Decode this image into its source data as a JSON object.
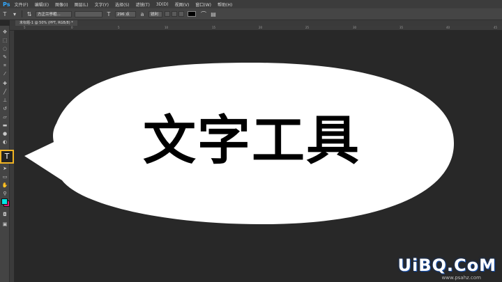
{
  "app": {
    "logo": "Ps"
  },
  "menu": [
    "文件(F)",
    "编辑(E)",
    "图像(I)",
    "图层(L)",
    "文字(Y)",
    "选择(S)",
    "滤镜(T)",
    "3D(D)",
    "视图(V)",
    "窗口(W)",
    "帮助(H)"
  ],
  "options": {
    "tool_icon": "T",
    "font_family": "方正兰亭粗...",
    "font_size": "296 点",
    "anti_alias": "锐利"
  },
  "document": {
    "tab_title": "未标题-1 @ 50% (PPT, RGB/8) *"
  },
  "ruler": {
    "labels": [
      "5",
      "0",
      "5",
      "10",
      "15",
      "20",
      "25",
      "30",
      "35",
      "40",
      "45"
    ]
  },
  "toolbox": {
    "active_tool": "type-tool",
    "foreground_color": "#00e5e5",
    "background_color": "#e0186c",
    "tools": [
      "move-icon",
      "marquee-icon",
      "lasso-icon",
      "quick-select-icon",
      "crop-icon",
      "eyedropper-icon",
      "healing-icon",
      "brush-icon",
      "stamp-icon",
      "history-brush-icon",
      "eraser-icon",
      "gradient-icon",
      "blur-icon",
      "dodge-icon",
      "pen-icon",
      "type-icon",
      "path-select-icon",
      "rectangle-icon",
      "hand-icon",
      "zoom-icon"
    ]
  },
  "canvas": {
    "text": "文字工具",
    "bubble_color": "#ffffff",
    "background_color": "#282828"
  },
  "watermark": {
    "text": "UiBQ.CoM",
    "sub": "www.psahz.com"
  }
}
